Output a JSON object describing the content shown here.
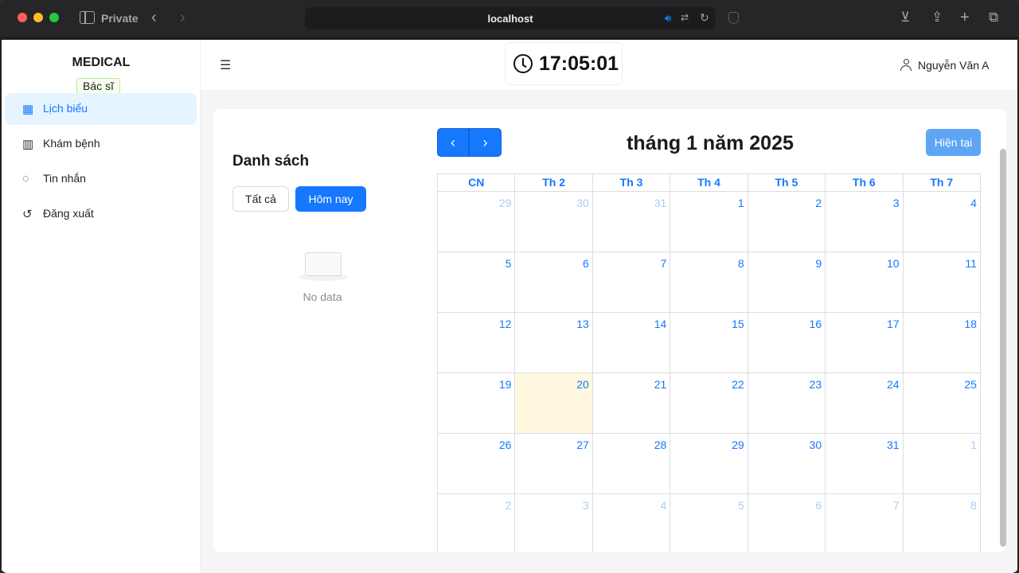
{
  "browser": {
    "mode_label": "Private",
    "url": "localhost"
  },
  "sidebar": {
    "brand": "MEDICAL",
    "role": "Bác sĩ",
    "items": [
      {
        "label": "Lịch biểu",
        "icon": "calendar-icon"
      },
      {
        "label": "Khám bệnh",
        "icon": "building-icon"
      },
      {
        "label": "Tin nhắn",
        "icon": "message-icon"
      },
      {
        "label": "Đăng xuất",
        "icon": "logout-icon"
      }
    ]
  },
  "header": {
    "clock": "17:05:01",
    "user_name": "Nguyễn Văn A"
  },
  "list": {
    "title": "Danh sách",
    "filter_all": "Tất cả",
    "filter_today": "Hôm nay",
    "empty_text": "No data"
  },
  "calendar": {
    "title": "tháng 1 năm 2025",
    "today_button": "Hiện tại",
    "weekdays": [
      "CN",
      "Th 2",
      "Th 3",
      "Th 4",
      "Th 5",
      "Th 6",
      "Th 7"
    ],
    "weeks": [
      [
        "29",
        "30",
        "31",
        "1",
        "2",
        "3",
        "4"
      ],
      [
        "5",
        "6",
        "7",
        "8",
        "9",
        "10",
        "11"
      ],
      [
        "12",
        "13",
        "14",
        "15",
        "16",
        "17",
        "18"
      ],
      [
        "19",
        "20",
        "21",
        "22",
        "23",
        "24",
        "25"
      ],
      [
        "26",
        "27",
        "28",
        "29",
        "30",
        "31",
        "1"
      ],
      [
        "2",
        "3",
        "4",
        "5",
        "6",
        "7",
        "8"
      ]
    ],
    "today_date": "20",
    "accent_color": "#1677ff",
    "today_highlight": "#fff8de"
  }
}
